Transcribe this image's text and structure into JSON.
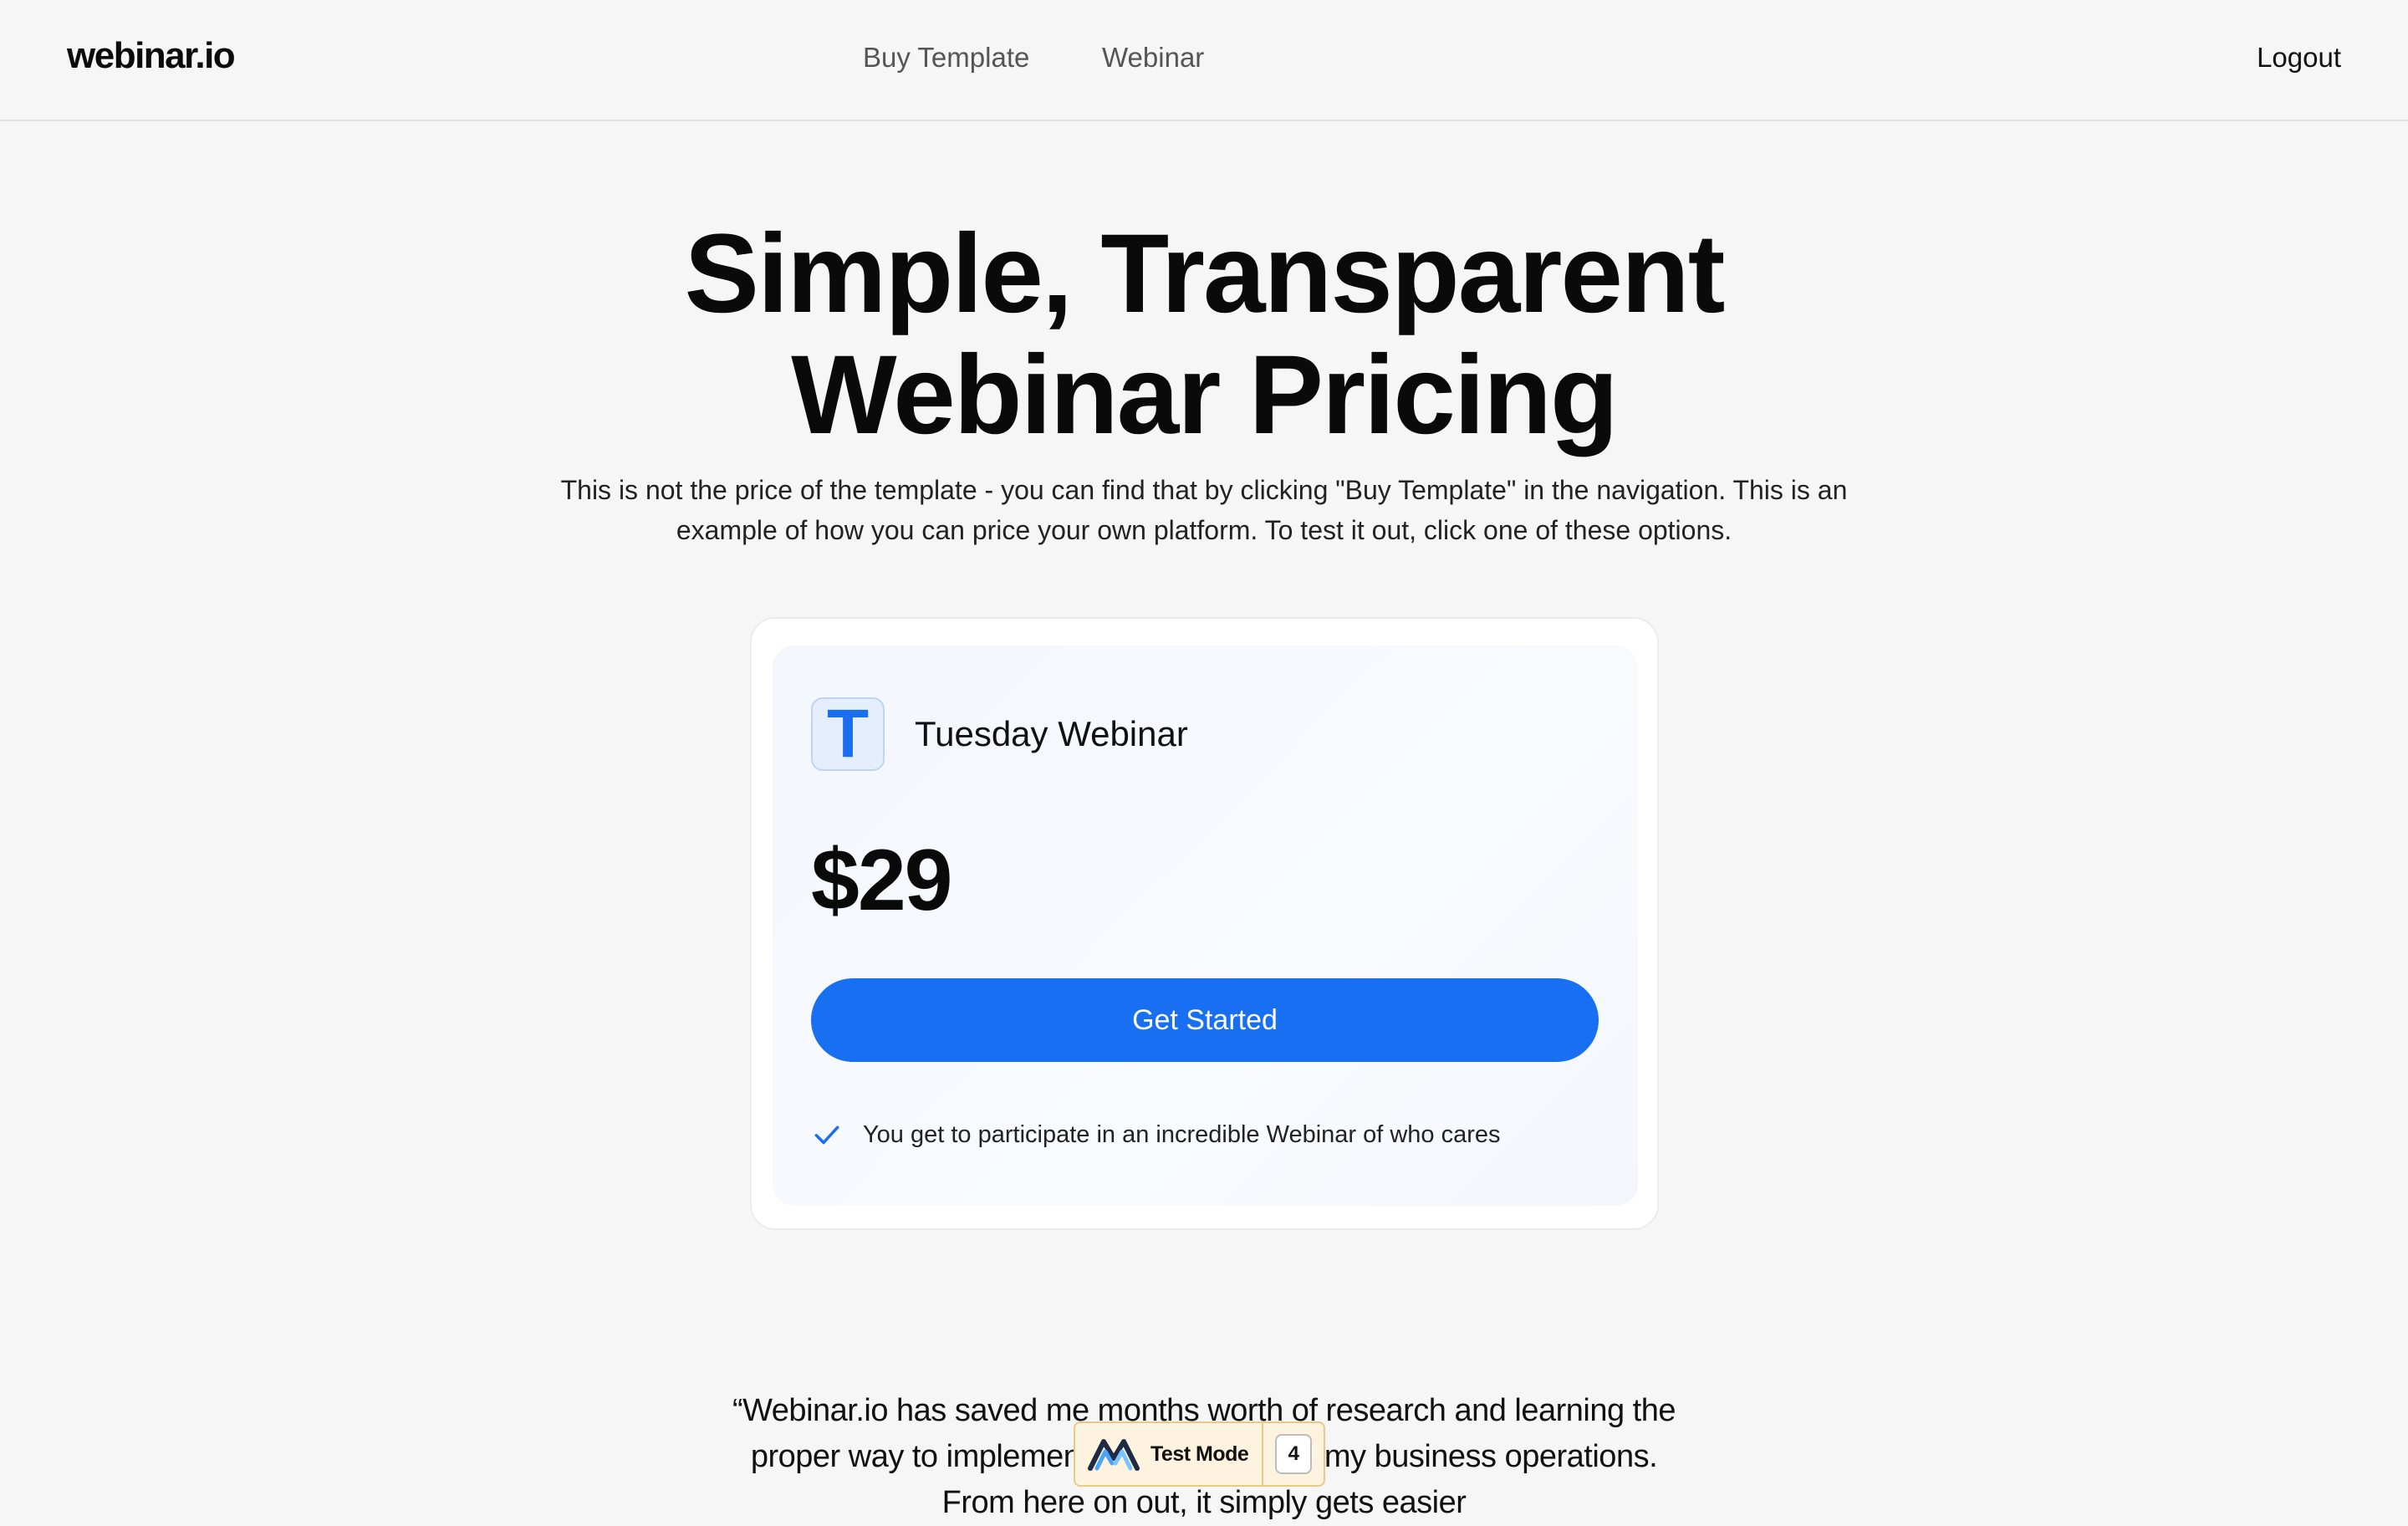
{
  "header": {
    "logo": "webinar.io",
    "nav": [
      {
        "label": "Buy Template"
      },
      {
        "label": "Webinar"
      }
    ],
    "logout_label": "Logout"
  },
  "hero": {
    "title_line1": "Simple, Transparent",
    "title_line2": "Webinar Pricing",
    "subtitle": "This is not the price of the template - you can find that by clicking \"Buy Template\" in the navigation. This is an example of how you can price your own platform. To test it out, click one of these options."
  },
  "plan": {
    "badge_letter": "T",
    "name": "Tuesday Webinar",
    "price": "$29",
    "cta_label": "Get Started",
    "features": [
      {
        "text": "You get to participate in an incredible Webinar of who cares"
      }
    ]
  },
  "testimonial": {
    "text": "“Webinar.io has saved me months worth of research and learning the proper way to implement ... information in my business operations. From here on out, it simply gets easier"
  },
  "test_mode": {
    "label": "Test Mode",
    "count": "4"
  },
  "colors": {
    "accent": "#186ff2",
    "background": "#f6f6f6",
    "badge_bg": "#e4eefc",
    "test_mode_bg": "#fdf3de"
  },
  "icons": {
    "check": "check-icon",
    "test_mode_logo": "test-mode-logo-icon"
  }
}
